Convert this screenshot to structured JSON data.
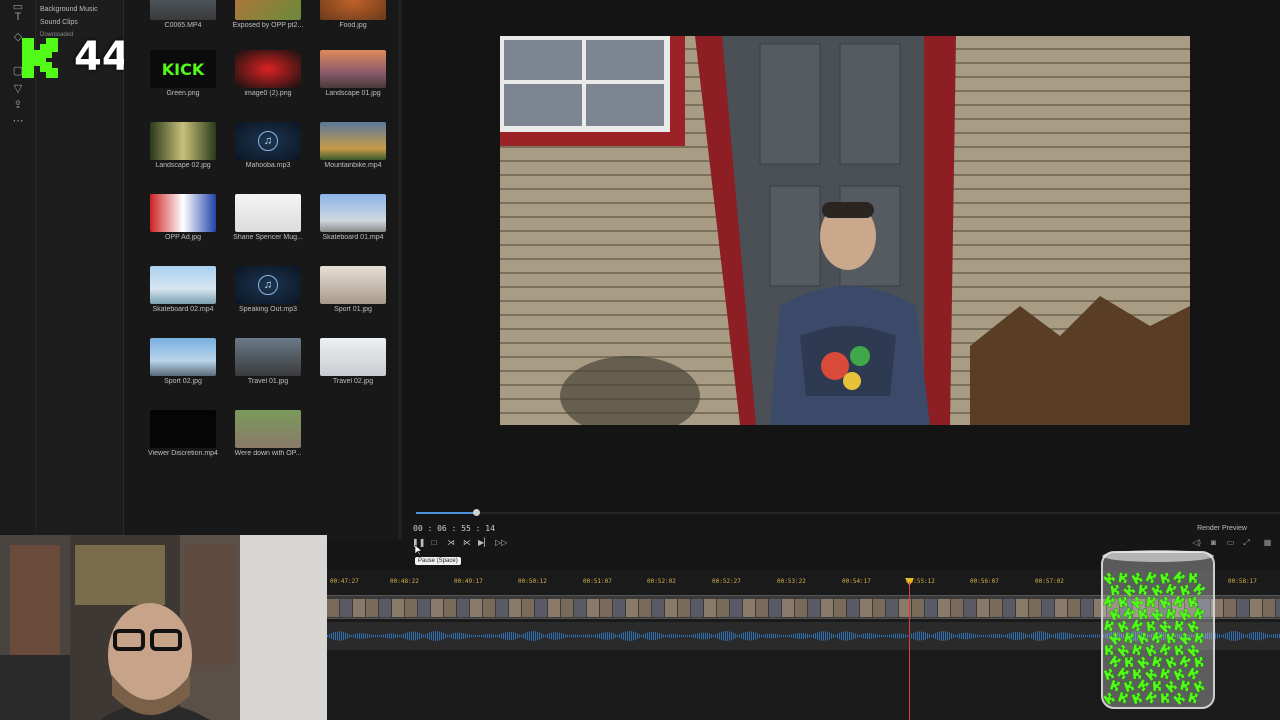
{
  "categories": {
    "items": [
      {
        "label": "Background Music"
      },
      {
        "label": "Sound Clips"
      },
      {
        "label": "Downloaded"
      }
    ]
  },
  "overlay": {
    "kick_count": "44"
  },
  "library": {
    "items": [
      {
        "label": "C0065.MP4",
        "thumb": "road"
      },
      {
        "label": "Exposed by OPP pt2...",
        "thumb": "food2"
      },
      {
        "label": "Food.jpg",
        "thumb": "food"
      },
      {
        "label": "Green.png",
        "thumb": "kick",
        "thumb_text": "KICK"
      },
      {
        "label": "image0 (2).png",
        "thumb": "opp"
      },
      {
        "label": "Landscape 01.jpg",
        "thumb": "landscape1"
      },
      {
        "label": "Landscape 02.jpg",
        "thumb": "forest"
      },
      {
        "label": "Mahooba.mp3",
        "thumb": "audio"
      },
      {
        "label": "Mountainbike.mp4",
        "thumb": "bike"
      },
      {
        "label": "OPP Ad.jpg",
        "thumb": "ad"
      },
      {
        "label": "Shane Spencer Mug...",
        "thumb": "doc"
      },
      {
        "label": "Skateboard 01.mp4",
        "thumb": "palms"
      },
      {
        "label": "Skateboard 02.mp4",
        "thumb": "skate"
      },
      {
        "label": "Speaking Out.mp3",
        "thumb": "audio"
      },
      {
        "label": "Sport 01.jpg",
        "thumb": "sport1"
      },
      {
        "label": "Sport 02.jpg",
        "thumb": "pier"
      },
      {
        "label": "Travel 01.jpg",
        "thumb": "car"
      },
      {
        "label": "Travel 02.jpg",
        "thumb": "travel2"
      },
      {
        "label": "Viewer Discretion.mp4",
        "thumb": "discretion"
      },
      {
        "label": "Were down with OP...",
        "thumb": "crowd"
      }
    ]
  },
  "transport": {
    "timecode": "00 : 06 : 55 : 14",
    "tooltip": "Pause (Space)",
    "render_preview": "Render Preview"
  },
  "timeline": {
    "ticks": [
      "00:47:27",
      "00:48:22",
      "00:49:17",
      "00:50:12",
      "00:51:07",
      "00:52:02",
      "00:52:27",
      "00:53:22",
      "00:54:17",
      "00:55:12",
      "00:56:07",
      "00:57:02",
      "00:58:17"
    ]
  },
  "colors": {
    "accent": "#4a90d9",
    "playhead": "#e23b3b",
    "ruler_text": "#d4b24a",
    "kick_green": "#53fc18"
  }
}
